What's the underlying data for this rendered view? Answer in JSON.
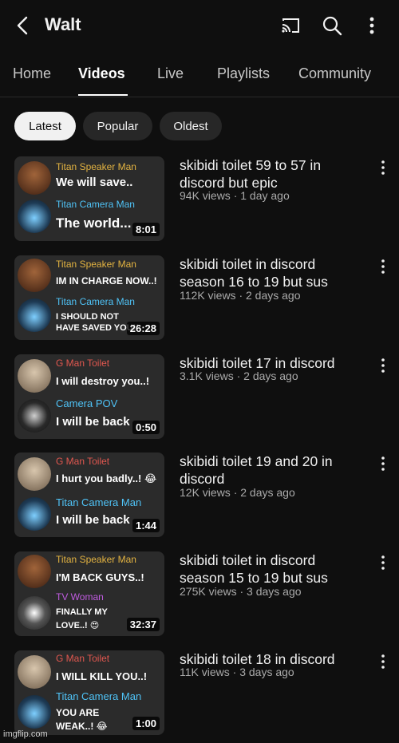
{
  "header": {
    "title": "Walt",
    "icons": [
      "back-icon",
      "cast-icon",
      "search-icon",
      "more-icon"
    ]
  },
  "tabs": [
    {
      "label": "Home"
    },
    {
      "label": "Videos"
    },
    {
      "label": "Live"
    },
    {
      "label": "Playlists"
    },
    {
      "label": "Community"
    }
  ],
  "active_tab": "Videos",
  "chips": [
    {
      "label": "Latest"
    },
    {
      "label": "Popular"
    },
    {
      "label": "Oldest"
    }
  ],
  "active_chip": "Latest",
  "videos": [
    {
      "title": "skibidi toilet 59 to 57 in discord but epic",
      "meta": "94K views · 1 day ago",
      "duration": "8:01",
      "thumb": {
        "name1": "Titan Speaker Man",
        "msg1": "We will save..",
        "name2": "Titan Camera Man",
        "msg2": "The world..."
      }
    },
    {
      "title": "skibidi toilet in discord season 16 to 19 but sus",
      "meta": "112K views · 2 days ago",
      "duration": "26:28",
      "thumb": {
        "name1": "Titan Speaker Man",
        "msg1": "IM IN CHARGE NOW..!",
        "name2": "Titan Camera Man",
        "msg2": "I SHOULD NOT HAVE SAVED YOU!!"
      }
    },
    {
      "title": "skibidi toilet 17 in discord",
      "meta": "3.1K views · 2 days ago",
      "duration": "0:50",
      "thumb": {
        "name1": "G Man Toilet",
        "msg1": "I will destroy you..!",
        "name2": "Camera POV",
        "msg2": "I will be back"
      }
    },
    {
      "title": "skibidi toilet 19 and 20 in discord",
      "meta": "12K views · 2 days ago",
      "duration": "1:44",
      "thumb": {
        "name1": "G Man Toilet",
        "msg1": "I hurt you badly..! 😂",
        "name2": "Titan Camera Man",
        "msg2": "I will be back"
      }
    },
    {
      "title": "skibidi toilet in discord season 15 to 19 but sus",
      "meta": "275K views · 3 days ago",
      "duration": "32:37",
      "thumb": {
        "name1": "Titan Speaker Man",
        "msg1": "I'M BACK GUYS..!",
        "name2": "TV Woman",
        "msg2": "FINALLY MY LOVE..! 😍"
      }
    },
    {
      "title": "skibidi toilet 18 in discord",
      "meta": "11K views · 3 days ago",
      "duration": "1:00",
      "thumb": {
        "name1": "G Man Toilet",
        "msg1": "I WILL KILL YOU..!",
        "name2": "Titan Camera Man",
        "msg2": "YOU ARE WEAK..! 😂"
      }
    }
  ],
  "watermark": "imgflip.com",
  "colors": {
    "background": "#0f0f0f",
    "chip_active_bg": "#f1f1f1",
    "chip_bg": "#272727",
    "meta_text": "#aaaaaa",
    "titan_speaker_name": "#e3b341",
    "titan_camera_name": "#4fc3f7",
    "gman_name": "#e0574f",
    "tv_woman_name": "#c05ce0"
  }
}
